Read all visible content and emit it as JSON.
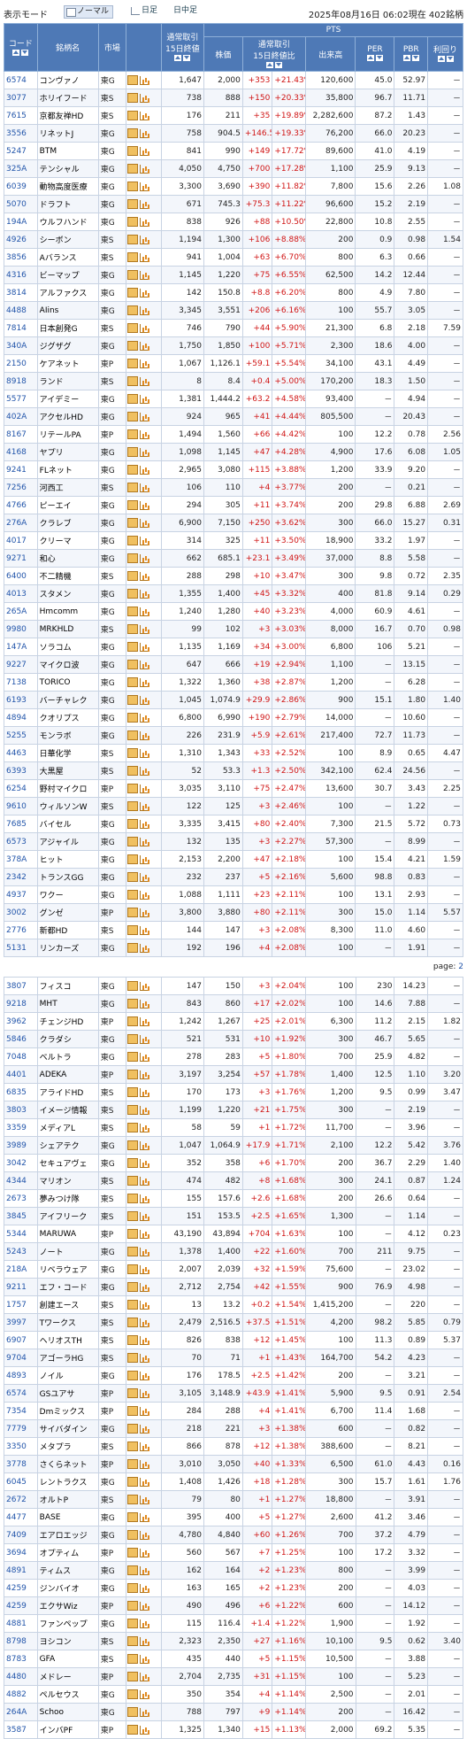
{
  "header": {
    "mode_label": "表示モード",
    "mode_normal": "ノーマル",
    "mode_daily": "日足",
    "mode_intraday": "日中足",
    "timestamp": "2025年08月16日 06:02現在 402銘柄"
  },
  "columns": {
    "code": "コード",
    "name": "銘柄名",
    "market": "市場",
    "regular": "通常取引\n15日終値",
    "pts": "PTS",
    "price": "株価",
    "change": "通常取引\n15日終値比",
    "volume": "出来高",
    "per": "PER",
    "pbr": "PBR",
    "yield": "利回り"
  },
  "rows_a": [
    [
      "6574",
      "コンヴァノ",
      "東G",
      "1,647",
      "2,000",
      "+353",
      "+21.43%",
      "120,600",
      "45.0",
      "52.97",
      "－"
    ],
    [
      "3077",
      "ホリイフード",
      "東S",
      "738",
      "888",
      "+150",
      "+20.33%",
      "35,800",
      "96.7",
      "11.71",
      "－"
    ],
    [
      "7615",
      "京都友禅HD",
      "東S",
      "176",
      "211",
      "+35",
      "+19.89%",
      "2,282,600",
      "87.2",
      "1.43",
      "－"
    ],
    [
      "3556",
      "リネットJ",
      "東G",
      "758",
      "904.5",
      "+146.5",
      "+19.33%",
      "76,200",
      "66.0",
      "20.23",
      "－"
    ],
    [
      "5247",
      "BTM",
      "東G",
      "841",
      "990",
      "+149",
      "+17.72%",
      "89,600",
      "41.0",
      "4.19",
      "－"
    ],
    [
      "325A",
      "テンシャル",
      "東G",
      "4,050",
      "4,750",
      "+700",
      "+17.28%",
      "1,100",
      "25.9",
      "9.13",
      "－"
    ],
    [
      "6039",
      "動物高度医療",
      "東G",
      "3,300",
      "3,690",
      "+390",
      "+11.82%",
      "7,800",
      "15.6",
      "2.26",
      "1.08"
    ],
    [
      "5070",
      "ドラフト",
      "東G",
      "671",
      "745.3",
      "+75.3",
      "+11.22%",
      "96,600",
      "15.2",
      "2.19",
      "－"
    ],
    [
      "194A",
      "ウルフハンド",
      "東G",
      "838",
      "926",
      "+88",
      "+10.50%",
      "22,800",
      "10.8",
      "2.55",
      "－"
    ],
    [
      "4926",
      "シーボン",
      "東S",
      "1,194",
      "1,300",
      "+106",
      "+8.88%",
      "200",
      "0.9",
      "0.98",
      "1.54"
    ],
    [
      "3856",
      "Aバランス",
      "東S",
      "941",
      "1,004",
      "+63",
      "+6.70%",
      "800",
      "6.3",
      "0.66",
      "－"
    ],
    [
      "4316",
      "ビーマップ",
      "東G",
      "1,145",
      "1,220",
      "+75",
      "+6.55%",
      "62,500",
      "14.2",
      "12.44",
      "－"
    ],
    [
      "3814",
      "アルファクス",
      "東G",
      "142",
      "150.8",
      "+8.8",
      "+6.20%",
      "800",
      "4.9",
      "7.80",
      "－"
    ],
    [
      "4488",
      "AIins",
      "東G",
      "3,345",
      "3,551",
      "+206",
      "+6.16%",
      "100",
      "55.7",
      "3.05",
      "－"
    ],
    [
      "7814",
      "日本創発G",
      "東S",
      "746",
      "790",
      "+44",
      "+5.90%",
      "21,300",
      "6.8",
      "2.18",
      "7.59"
    ],
    [
      "340A",
      "ジグザグ",
      "東G",
      "1,750",
      "1,850",
      "+100",
      "+5.71%",
      "2,300",
      "18.6",
      "4.00",
      "－"
    ],
    [
      "2150",
      "ケアネット",
      "東P",
      "1,067",
      "1,126.1",
      "+59.1",
      "+5.54%",
      "34,100",
      "43.1",
      "4.49",
      "－"
    ],
    [
      "8918",
      "ランド",
      "東S",
      "8",
      "8.4",
      "+0.4",
      "+5.00%",
      "170,200",
      "18.3",
      "1.50",
      "－"
    ],
    [
      "5577",
      "アイデミー",
      "東G",
      "1,381",
      "1,444.2",
      "+63.2",
      "+4.58%",
      "93,400",
      "－",
      "4.94",
      "－"
    ],
    [
      "402A",
      "アクセルHD",
      "東G",
      "924",
      "965",
      "+41",
      "+4.44%",
      "805,500",
      "－",
      "20.43",
      "－"
    ],
    [
      "8167",
      "リテールPA",
      "東P",
      "1,494",
      "1,560",
      "+66",
      "+4.42%",
      "100",
      "12.2",
      "0.78",
      "2.56"
    ],
    [
      "4168",
      "ヤプリ",
      "東G",
      "1,098",
      "1,145",
      "+47",
      "+4.28%",
      "4,900",
      "17.6",
      "6.08",
      "1.05"
    ],
    [
      "9241",
      "FLネット",
      "東G",
      "2,965",
      "3,080",
      "+115",
      "+3.88%",
      "1,200",
      "33.9",
      "9.20",
      "－"
    ],
    [
      "7256",
      "河西工",
      "東S",
      "106",
      "110",
      "+4",
      "+3.77%",
      "200",
      "－",
      "0.21",
      "－"
    ],
    [
      "4766",
      "ピーエイ",
      "東G",
      "294",
      "305",
      "+11",
      "+3.74%",
      "200",
      "29.8",
      "6.88",
      "2.69"
    ],
    [
      "276A",
      "クラレブ",
      "東G",
      "6,900",
      "7,150",
      "+250",
      "+3.62%",
      "300",
      "66.0",
      "15.27",
      "0.31"
    ],
    [
      "4017",
      "クリーマ",
      "東G",
      "314",
      "325",
      "+11",
      "+3.50%",
      "18,900",
      "33.2",
      "1.97",
      "－"
    ],
    [
      "9271",
      "和心",
      "東G",
      "662",
      "685.1",
      "+23.1",
      "+3.49%",
      "37,000",
      "8.8",
      "5.58",
      "－"
    ],
    [
      "6400",
      "不二精機",
      "東S",
      "288",
      "298",
      "+10",
      "+3.47%",
      "300",
      "9.8",
      "0.72",
      "2.35"
    ],
    [
      "4013",
      "スタメン",
      "東G",
      "1,355",
      "1,400",
      "+45",
      "+3.32%",
      "400",
      "81.8",
      "9.14",
      "0.29"
    ],
    [
      "265A",
      "Hmcomm",
      "東G",
      "1,240",
      "1,280",
      "+40",
      "+3.23%",
      "4,000",
      "60.9",
      "4.61",
      "－"
    ],
    [
      "9980",
      "MRKHLD",
      "東S",
      "99",
      "102",
      "+3",
      "+3.03%",
      "8,000",
      "16.7",
      "0.70",
      "0.98"
    ],
    [
      "147A",
      "ソラコム",
      "東G",
      "1,135",
      "1,169",
      "+34",
      "+3.00%",
      "6,800",
      "106",
      "5.21",
      "－"
    ],
    [
      "9227",
      "マイクロ波",
      "東G",
      "647",
      "666",
      "+19",
      "+2.94%",
      "1,100",
      "－",
      "13.15",
      "－"
    ],
    [
      "7138",
      "TORICO",
      "東G",
      "1,322",
      "1,360",
      "+38",
      "+2.87%",
      "1,200",
      "－",
      "6.28",
      "－"
    ],
    [
      "6193",
      "バーチャレク",
      "東G",
      "1,045",
      "1,074.9",
      "+29.9",
      "+2.86%",
      "900",
      "15.1",
      "1.80",
      "1.40"
    ],
    [
      "4894",
      "クオリプス",
      "東G",
      "6,800",
      "6,990",
      "+190",
      "+2.79%",
      "14,000",
      "－",
      "10.60",
      "－"
    ],
    [
      "5255",
      "モンラボ",
      "東G",
      "226",
      "231.9",
      "+5.9",
      "+2.61%",
      "217,400",
      "72.7",
      "11.73",
      "－"
    ],
    [
      "4463",
      "日華化学",
      "東S",
      "1,310",
      "1,343",
      "+33",
      "+2.52%",
      "100",
      "8.9",
      "0.65",
      "4.47"
    ],
    [
      "6393",
      "大黒屋",
      "東S",
      "52",
      "53.3",
      "+1.3",
      "+2.50%",
      "342,100",
      "62.4",
      "24.56",
      "－"
    ],
    [
      "6254",
      "野村マイクロ",
      "東P",
      "3,035",
      "3,110",
      "+75",
      "+2.47%",
      "13,600",
      "30.7",
      "3.43",
      "2.25"
    ],
    [
      "9610",
      "ウィルソンW",
      "東S",
      "122",
      "125",
      "+3",
      "+2.46%",
      "100",
      "－",
      "1.22",
      "－"
    ],
    [
      "7685",
      "バイセル",
      "東G",
      "3,335",
      "3,415",
      "+80",
      "+2.40%",
      "7,300",
      "21.5",
      "5.72",
      "0.73"
    ],
    [
      "6573",
      "アジャイル",
      "東G",
      "132",
      "135",
      "+3",
      "+2.27%",
      "57,300",
      "－",
      "8.99",
      "－"
    ],
    [
      "378A",
      "ヒット",
      "東G",
      "2,153",
      "2,200",
      "+47",
      "+2.18%",
      "100",
      "15.4",
      "4.21",
      "1.59"
    ],
    [
      "2342",
      "トランスGG",
      "東G",
      "232",
      "237",
      "+5",
      "+2.16%",
      "5,600",
      "98.8",
      "0.83",
      "－"
    ],
    [
      "4937",
      "ワクー",
      "東G",
      "1,088",
      "1,111",
      "+23",
      "+2.11%",
      "100",
      "13.1",
      "2.93",
      "－"
    ],
    [
      "3002",
      "グンゼ",
      "東P",
      "3,800",
      "3,880",
      "+80",
      "+2.11%",
      "300",
      "15.0",
      "1.14",
      "5.57"
    ],
    [
      "2776",
      "新都HD",
      "東S",
      "144",
      "147",
      "+3",
      "+2.08%",
      "8,300",
      "11.0",
      "4.60",
      "－"
    ],
    [
      "5131",
      "リンカーズ",
      "東G",
      "192",
      "196",
      "+4",
      "+2.08%",
      "100",
      "－",
      "1.91",
      "－"
    ]
  ],
  "page_label": "page:",
  "page_number": "2",
  "rows_b": [
    [
      "3807",
      "フィスコ",
      "東G",
      "147",
      "150",
      "+3",
      "+2.04%",
      "100",
      "230",
      "14.23",
      "－"
    ],
    [
      "9218",
      "MHT",
      "東G",
      "843",
      "860",
      "+17",
      "+2.02%",
      "100",
      "14.6",
      "7.88",
      "－"
    ],
    [
      "3962",
      "チェンジHD",
      "東P",
      "1,242",
      "1,267",
      "+25",
      "+2.01%",
      "6,300",
      "11.2",
      "2.15",
      "1.82"
    ],
    [
      "5846",
      "クラダシ",
      "東G",
      "521",
      "531",
      "+10",
      "+1.92%",
      "300",
      "46.7",
      "5.65",
      "－"
    ],
    [
      "7048",
      "ベルトラ",
      "東G",
      "278",
      "283",
      "+5",
      "+1.80%",
      "700",
      "25.9",
      "4.82",
      "－"
    ],
    [
      "4401",
      "ADEKA",
      "東P",
      "3,197",
      "3,254",
      "+57",
      "+1.78%",
      "1,400",
      "12.5",
      "1.10",
      "3.20"
    ],
    [
      "6835",
      "アライドHD",
      "東S",
      "170",
      "173",
      "+3",
      "+1.76%",
      "1,200",
      "9.5",
      "0.99",
      "3.47"
    ],
    [
      "3803",
      "イメージ情報",
      "東S",
      "1,199",
      "1,220",
      "+21",
      "+1.75%",
      "300",
      "－",
      "2.19",
      "－"
    ],
    [
      "3359",
      "メディアL",
      "東S",
      "58",
      "59",
      "+1",
      "+1.72%",
      "11,700",
      "－",
      "3.96",
      "－"
    ],
    [
      "3989",
      "シェアテク",
      "東G",
      "1,047",
      "1,064.9",
      "+17.9",
      "+1.71%",
      "2,100",
      "12.2",
      "5.42",
      "3.76"
    ],
    [
      "3042",
      "セキュアヴェ",
      "東G",
      "352",
      "358",
      "+6",
      "+1.70%",
      "200",
      "36.7",
      "2.29",
      "1.40"
    ],
    [
      "4344",
      "マリオン",
      "東S",
      "474",
      "482",
      "+8",
      "+1.68%",
      "300",
      "24.1",
      "0.87",
      "1.24"
    ],
    [
      "2673",
      "夢みつけ隊",
      "東S",
      "155",
      "157.6",
      "+2.6",
      "+1.68%",
      "200",
      "26.6",
      "0.64",
      "－"
    ],
    [
      "3845",
      "アイフリーク",
      "東S",
      "151",
      "153.5",
      "+2.5",
      "+1.65%",
      "1,300",
      "－",
      "1.14",
      "－"
    ],
    [
      "5344",
      "MARUWA",
      "東P",
      "43,190",
      "43,894",
      "+704",
      "+1.63%",
      "100",
      "－",
      "4.12",
      "0.23"
    ],
    [
      "5243",
      "ノート",
      "東G",
      "1,378",
      "1,400",
      "+22",
      "+1.60%",
      "700",
      "211",
      "9.75",
      "－"
    ],
    [
      "218A",
      "リベラウェア",
      "東G",
      "2,007",
      "2,039",
      "+32",
      "+1.59%",
      "75,600",
      "－",
      "23.02",
      "－"
    ],
    [
      "9211",
      "エフ・コード",
      "東G",
      "2,712",
      "2,754",
      "+42",
      "+1.55%",
      "900",
      "76.9",
      "4.98",
      "－"
    ],
    [
      "1757",
      "創建エース",
      "東S",
      "13",
      "13.2",
      "+0.2",
      "+1.54%",
      "1,415,200",
      "－",
      "220",
      "－"
    ],
    [
      "3997",
      "Tワークス",
      "東S",
      "2,479",
      "2,516.5",
      "+37.5",
      "+1.51%",
      "4,200",
      "98.2",
      "5.85",
      "0.79"
    ],
    [
      "6907",
      "ヘリオスTH",
      "東S",
      "826",
      "838",
      "+12",
      "+1.45%",
      "100",
      "11.3",
      "0.89",
      "5.37"
    ],
    [
      "9704",
      "アゴーラHG",
      "東S",
      "70",
      "71",
      "+1",
      "+1.43%",
      "164,700",
      "54.2",
      "4.23",
      "－"
    ],
    [
      "4893",
      "ノイル",
      "東G",
      "176",
      "178.5",
      "+2.5",
      "+1.42%",
      "200",
      "－",
      "3.21",
      "－"
    ],
    [
      "6574",
      "GSユアサ",
      "東P",
      "3,105",
      "3,148.9",
      "+43.9",
      "+1.41%",
      "5,900",
      "9.5",
      "0.91",
      "2.54"
    ],
    [
      "7354",
      "Dmミックス",
      "東P",
      "284",
      "288",
      "+4",
      "+1.41%",
      "6,700",
      "11.4",
      "1.68",
      "－"
    ],
    [
      "7779",
      "サイバダイン",
      "東G",
      "218",
      "221",
      "+3",
      "+1.38%",
      "600",
      "－",
      "0.82",
      "－"
    ],
    [
      "3350",
      "メタプラ",
      "東S",
      "866",
      "878",
      "+12",
      "+1.38%",
      "388,600",
      "－",
      "8.21",
      "－"
    ],
    [
      "3778",
      "さくらネット",
      "東P",
      "3,010",
      "3,050",
      "+40",
      "+1.33%",
      "6,500",
      "61.0",
      "4.43",
      "0.16"
    ],
    [
      "6045",
      "レントラクス",
      "東G",
      "1,408",
      "1,426",
      "+18",
      "+1.28%",
      "300",
      "15.7",
      "1.61",
      "1.76"
    ],
    [
      "2672",
      "オルトP",
      "東S",
      "79",
      "80",
      "+1",
      "+1.27%",
      "18,800",
      "－",
      "3.91",
      "－"
    ],
    [
      "4477",
      "BASE",
      "東G",
      "395",
      "400",
      "+5",
      "+1.27%",
      "2,600",
      "41.2",
      "3.46",
      "－"
    ],
    [
      "7409",
      "エアロエッジ",
      "東G",
      "4,780",
      "4,840",
      "+60",
      "+1.26%",
      "700",
      "37.2",
      "4.79",
      "－"
    ],
    [
      "3694",
      "オプティム",
      "東P",
      "560",
      "567",
      "+7",
      "+1.25%",
      "100",
      "17.2",
      "3.32",
      "－"
    ],
    [
      "4891",
      "ティムス",
      "東G",
      "162",
      "164",
      "+2",
      "+1.23%",
      "800",
      "－",
      "3.99",
      "－"
    ],
    [
      "4259",
      "ジンバイオ",
      "東G",
      "163",
      "165",
      "+2",
      "+1.23%",
      "200",
      "－",
      "4.03",
      "－"
    ],
    [
      "4259",
      "エクサWiz",
      "東P",
      "490",
      "496",
      "+6",
      "+1.22%",
      "600",
      "－",
      "14.12",
      "－"
    ],
    [
      "4881",
      "ファンペップ",
      "東G",
      "115",
      "116.4",
      "+1.4",
      "+1.22%",
      "1,900",
      "－",
      "1.92",
      "－"
    ],
    [
      "8798",
      "ヨシコン",
      "東S",
      "2,323",
      "2,350",
      "+27",
      "+1.16%",
      "10,100",
      "9.5",
      "0.62",
      "3.40"
    ],
    [
      "8783",
      "GFA",
      "東S",
      "435",
      "440",
      "+5",
      "+1.15%",
      "10,500",
      "－",
      "3.88",
      "－"
    ],
    [
      "4480",
      "メドレー",
      "東P",
      "2,704",
      "2,735",
      "+31",
      "+1.15%",
      "100",
      "－",
      "5.23",
      "－"
    ],
    [
      "4882",
      "ペルセウス",
      "東G",
      "350",
      "354",
      "+4",
      "+1.14%",
      "2,500",
      "－",
      "2.01",
      "－"
    ],
    [
      "264A",
      "Schoo",
      "東G",
      "788",
      "797",
      "+9",
      "+1.14%",
      "200",
      "－",
      "16.42",
      "－"
    ],
    [
      "3587",
      "インバPF",
      "東P",
      "1,325",
      "1,340",
      "+15",
      "+1.13%",
      "2,000",
      "69.2",
      "5.35",
      "－"
    ]
  ]
}
